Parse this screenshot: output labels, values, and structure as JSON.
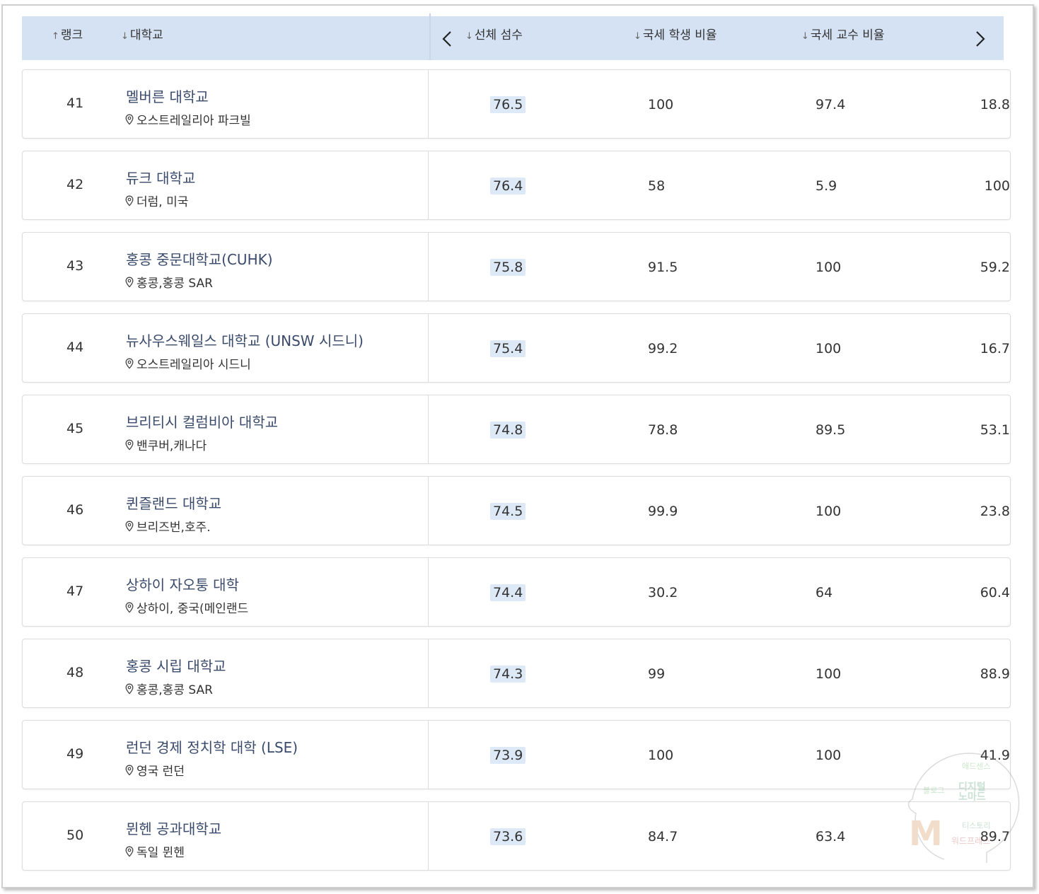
{
  "header": {
    "rank": "랭크",
    "university": "대학교",
    "overall": "선체 섬수",
    "intl_students": "국세 학생 비율",
    "intl_faculty": "국세 교수 비율"
  },
  "rows": [
    {
      "rank": "41",
      "name": "멜버른 대학교",
      "location": "오스트레일리아 파크빌",
      "overall": "76.5",
      "v1": "100",
      "v2": "97.4",
      "v3": "18.8"
    },
    {
      "rank": "42",
      "name": "듀크 대학교",
      "location": "더럼, 미국",
      "overall": "76.4",
      "v1": "58",
      "v2": "5.9",
      "v3": "100"
    },
    {
      "rank": "43",
      "name": "홍콩 중문대학교(CUHK)",
      "location": "홍콩,홍콩 SAR",
      "overall": "75.8",
      "v1": "91.5",
      "v2": "100",
      "v3": "59.2"
    },
    {
      "rank": "44",
      "name": "뉴사우스웨일스 대학교 (UNSW 시드니)",
      "location": "오스트레일리아 시드니",
      "overall": "75.4",
      "v1": "99.2",
      "v2": "100",
      "v3": "16.7"
    },
    {
      "rank": "45",
      "name": "브리티시 컬럼비아 대학교",
      "location": "밴쿠버,캐나다",
      "overall": "74.8",
      "v1": "78.8",
      "v2": "89.5",
      "v3": "53.1"
    },
    {
      "rank": "46",
      "name": "퀸즐랜드 대학교",
      "location": "브리즈번,호주.",
      "overall": "74.5",
      "v1": "99.9",
      "v2": "100",
      "v3": "23.8"
    },
    {
      "rank": "47",
      "name": "상하이 자오퉁 대학",
      "location": "상하이, 중국(메인랜드",
      "overall": "74.4",
      "v1": "30.2",
      "v2": "64",
      "v3": "60.4"
    },
    {
      "rank": "48",
      "name": "홍콩 시립 대학교",
      "location": "홍콩,홍콩 SAR",
      "overall": "74.3",
      "v1": "99",
      "v2": "100",
      "v3": "88.9"
    },
    {
      "rank": "49",
      "name": "런던 경제 정치학 대학 (LSE)",
      "location": "영국 런던",
      "overall": "73.9",
      "v1": "100",
      "v2": "100",
      "v3": "41.9"
    },
    {
      "rank": "50",
      "name": "뮌헨 공과대학교",
      "location": "독일 뮌헨",
      "overall": "73.6",
      "v1": "84.7",
      "v2": "63.4",
      "v3": "89.7"
    }
  ],
  "watermark": {
    "letter": "M",
    "words": [
      "애드센스",
      "디지털",
      "노마드",
      "블로그",
      "워드프레스",
      "티스토리"
    ]
  },
  "colors": {
    "header_bg": "#d4e2f4",
    "score_bg": "#dde9f6",
    "name_color": "#3a4a6b"
  }
}
